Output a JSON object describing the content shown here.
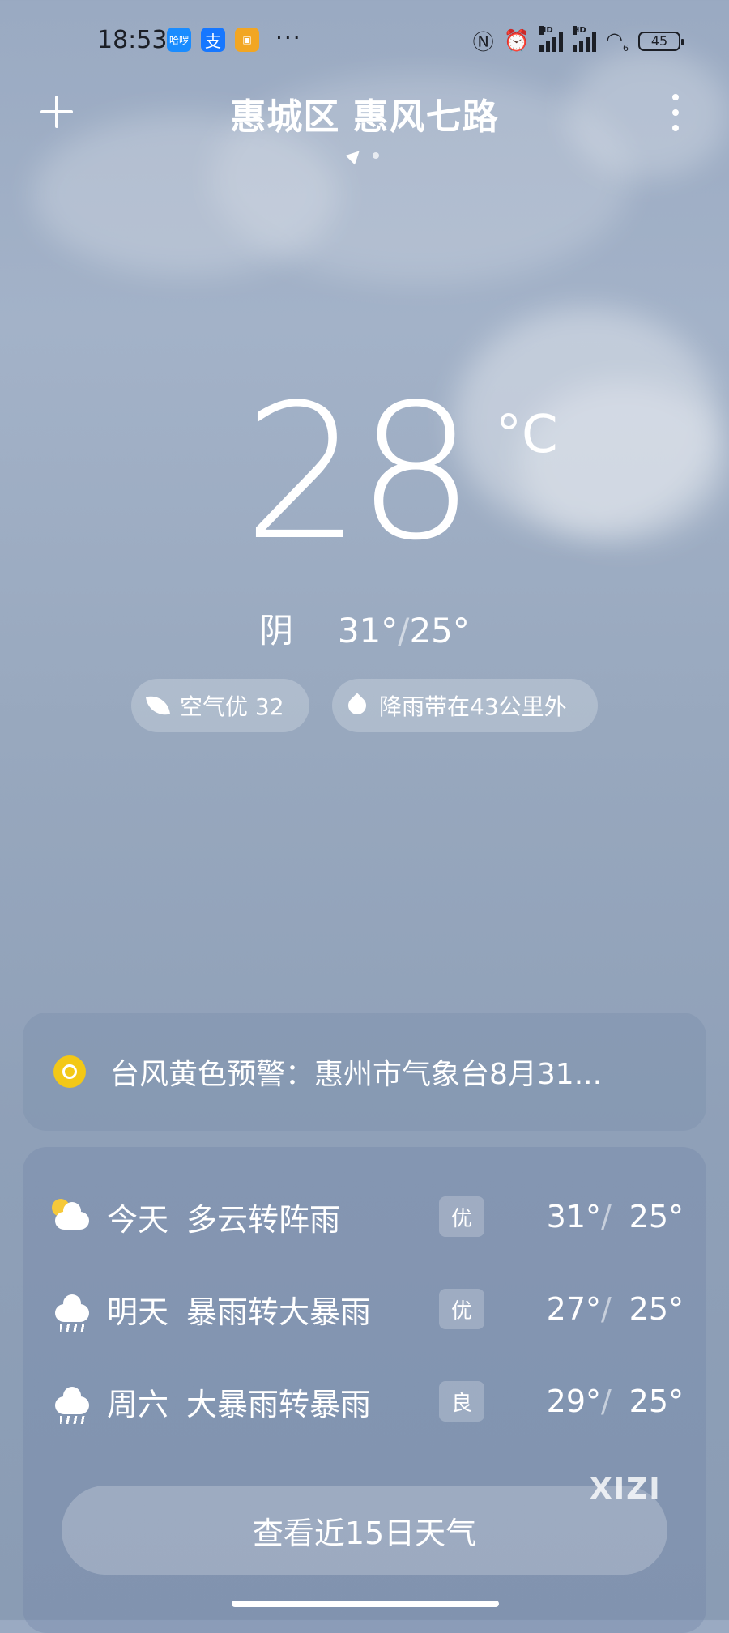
{
  "status_bar": {
    "time": "18:53",
    "app_badges": [
      "哈啰",
      "支",
      ""
    ],
    "overflow": "···",
    "network_label": "HD",
    "wifi_label": "6",
    "battery": "45"
  },
  "header": {
    "location": "惠城区 惠风七路"
  },
  "current": {
    "temperature": "28",
    "unit": "°C",
    "condition": "阴",
    "high": "31°",
    "separator": "/",
    "low": "25°",
    "air_quality": "空气优 32",
    "rain_info": "降雨带在43公里外"
  },
  "alert": {
    "text": "台风黄色预警：惠州市气象台8月31..."
  },
  "forecast": [
    {
      "day": "今天",
      "condition": "多云转阵雨",
      "aqi": "优",
      "high": "31°",
      "low": "25°",
      "icon": "partly-cloudy-night-icon"
    },
    {
      "day": "明天",
      "condition": "暴雨转大暴雨",
      "aqi": "优",
      "high": "27°",
      "low": "25°",
      "icon": "rain-icon"
    },
    {
      "day": "周六",
      "condition": "大暴雨转暴雨",
      "aqi": "良",
      "high": "29°",
      "low": "25°",
      "icon": "rain-icon"
    }
  ],
  "cta_label": "查看近15日天气",
  "watermark": "XIZI",
  "colors": {
    "alert_icon": "#f3c816",
    "status_text": "#1c1f26"
  }
}
